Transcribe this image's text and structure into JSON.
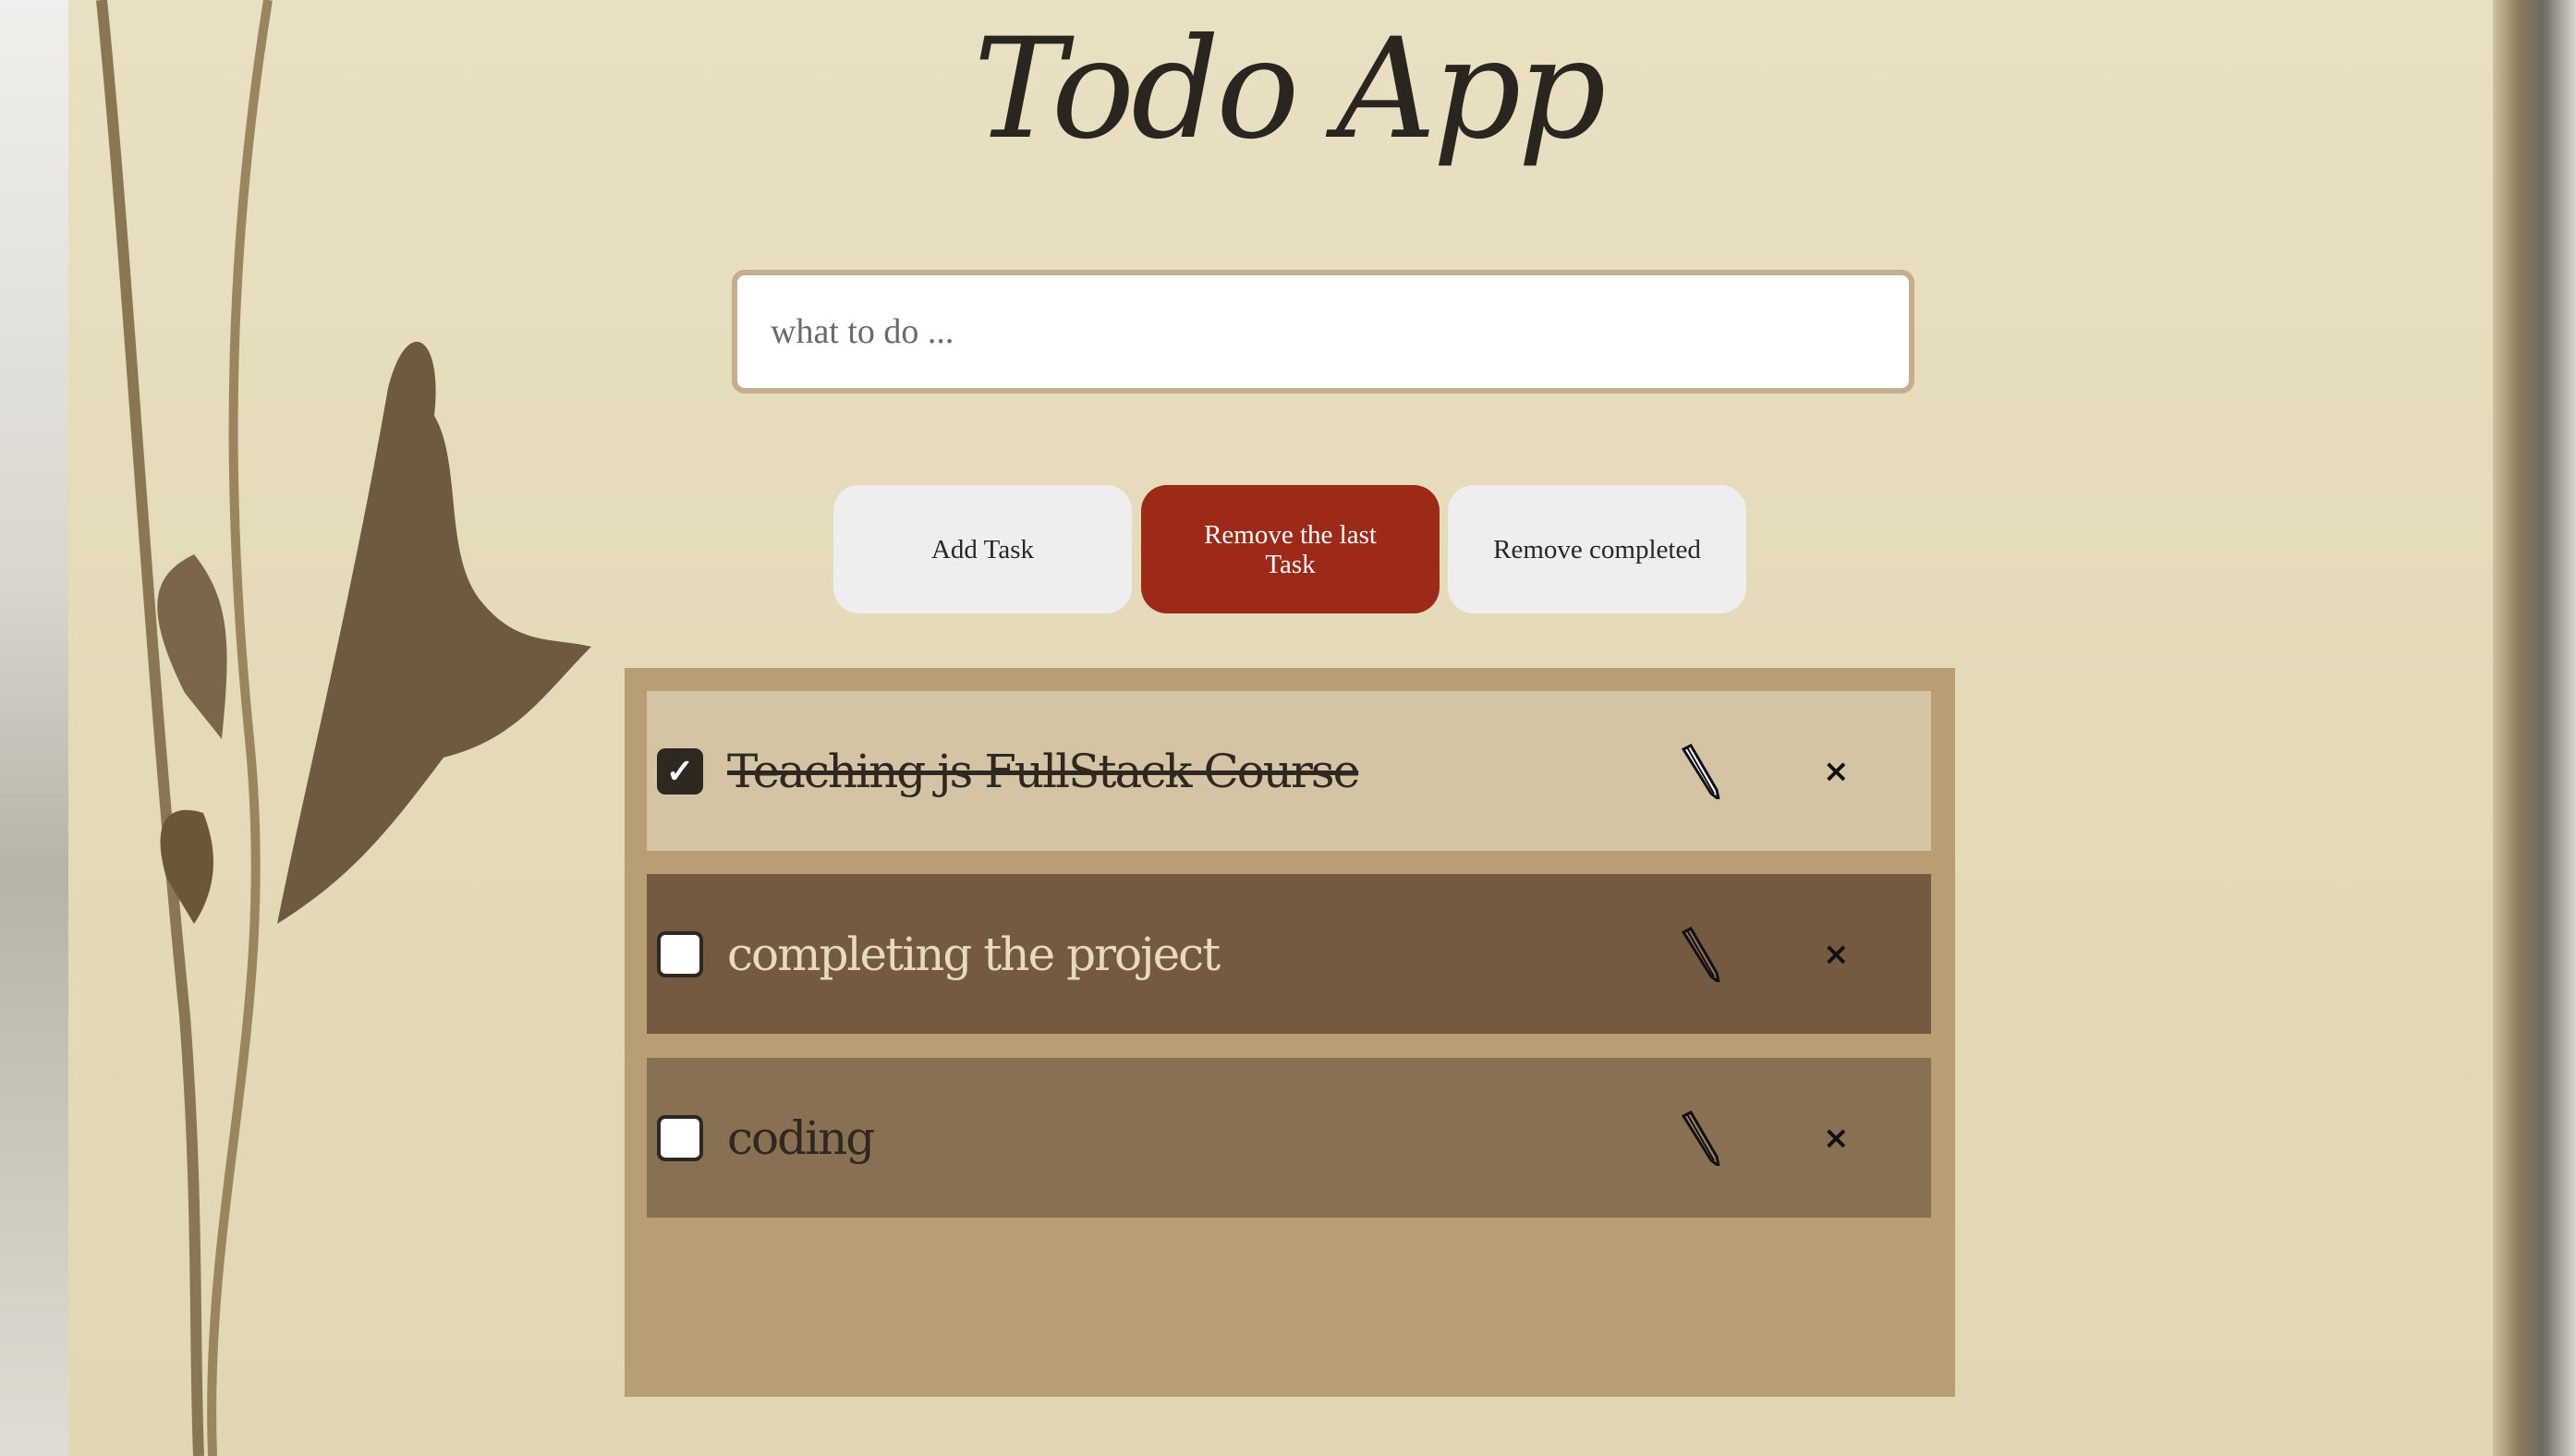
{
  "header": {
    "title": "Todo App"
  },
  "input": {
    "placeholder": "what to do ...",
    "value": ""
  },
  "buttons": {
    "add": "Add Task",
    "remove_last": "Remove the last Task",
    "remove_completed": "Remove completed"
  },
  "tasks": [
    {
      "text": "Teaching js FullStack Course",
      "completed": true,
      "check": "✓",
      "delete": "×"
    },
    {
      "text": "completing the project",
      "completed": false,
      "check": "",
      "delete": "×"
    },
    {
      "text": "coding",
      "completed": false,
      "check": "",
      "delete": "×"
    }
  ],
  "colors": {
    "accent_red": "#9d2a19",
    "panel": "#b99e74",
    "row1": "#d3c5a3",
    "row2": "#735a40",
    "row3": "#877152"
  }
}
